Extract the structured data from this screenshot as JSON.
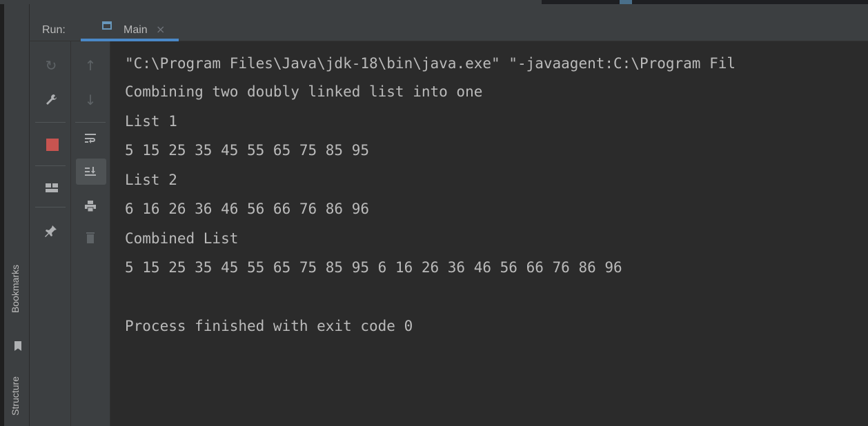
{
  "side_tabs": {
    "bookmarks": "Bookmarks",
    "structure": "Structure"
  },
  "header": {
    "run_label": "Run:",
    "tab_label": "Main",
    "tab_close": "×"
  },
  "toolbar_left": [
    {
      "name": "rerun-icon",
      "glyph": "↻"
    },
    {
      "name": "wrench-icon",
      "glyph": "🔧"
    },
    {
      "name": "stop-icon",
      "glyph": ""
    },
    {
      "name": "layout-icon",
      "glyph": ""
    },
    {
      "name": "pin-icon",
      "glyph": "📌"
    }
  ],
  "toolbar_right": [
    {
      "name": "up-arrow-icon",
      "glyph": "↑"
    },
    {
      "name": "down-arrow-icon",
      "glyph": "↓"
    },
    {
      "name": "soft-wrap-icon",
      "glyph": "⮐"
    },
    {
      "name": "scroll-to-end-icon",
      "glyph": "⤓"
    },
    {
      "name": "print-icon",
      "glyph": "🖶"
    },
    {
      "name": "trash-icon",
      "glyph": "🗑"
    }
  ],
  "console": {
    "lines": [
      "\"C:\\Program Files\\Java\\jdk-18\\bin\\java.exe\" \"-javaagent:C:\\Program Fil",
      "Combining two doubly linked list into one",
      "List 1",
      "5 15 25 35 45 55 65 75 85 95",
      "List 2",
      "6 16 26 36 46 56 66 76 86 96",
      "Combined List",
      "5 15 25 35 45 55 65 75 85 95 6 16 26 36 46 56 66 76 86 96",
      "",
      "Process finished with exit code 0"
    ]
  },
  "colors": {
    "background": "#2b2b2b",
    "panel": "#3c3f41",
    "text": "#bbbbbb",
    "stop": "#c75450",
    "accent": "#4a88c7"
  }
}
